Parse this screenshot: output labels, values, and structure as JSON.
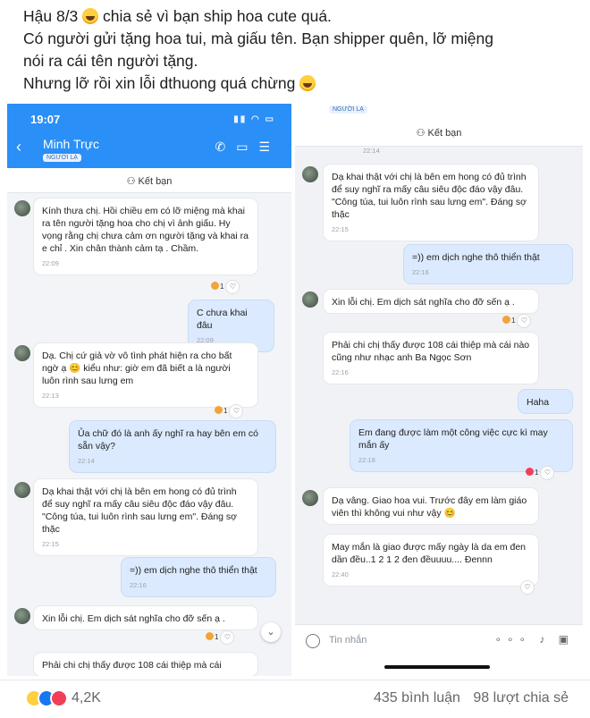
{
  "caption": {
    "line1_pre": "Hậu 8/3",
    "line1_post": "chia sẻ vì bạn ship hoa cute quá.",
    "line2": "Có người gửi tặng hoa tui, mà giấu tên. Bạn shipper quên, lỡ miệng",
    "line3": "nói ra cái tên người tặng.",
    "line4": "Nhưng lỡ rồi xin lỗi dthuong quá chừng",
    "emoji": "laughing-face-icon"
  },
  "left_phone": {
    "time": "19:07",
    "contact_name": "Minh Trực",
    "stranger_badge": "NGƯỜI LẠ",
    "add_friend": "Kết bạn",
    "messages": [
      {
        "text": "Kính thưa chị. Hồi chiều em có lỡ miệng mà khai ra tên người tặng hoa cho chị vì ảnh giấu. Hy vọng rằng chị chưa cảm ơn người tặng và khai ra e chỉ . Xin chân thành cảm tạ . Chầm.",
        "time": "22:09",
        "react": "1"
      },
      {
        "text": "C chưa khai đâu",
        "time": "22:09"
      },
      {
        "text": "Dạ. Chị cứ giả vờ vô tình phát hiện ra cho bất ngờ ạ 😊 kiểu như: giờ em đã biết a là người luôn rình sau lưng em",
        "time": "22:13",
        "react": "1"
      },
      {
        "text": "Ủa chữ đó là anh ấy nghĩ ra hay bên em có sẵn vậy?",
        "time": "22:14"
      },
      {
        "text": "Dạ khai thật với chị là bên em hong có đủ trình để suy nghĩ ra mấy câu siêu độc đáo vậy đâu. \"Công túa, tui luôn rình sau lưng em\". Đáng sợ thặc",
        "time": "22:15"
      },
      {
        "text": "=)) em dịch nghe thô thiển thật",
        "time": "22:16"
      },
      {
        "text": "Xin lỗi chị. Em dịch sát nghĩa cho đỡ sến ạ .",
        "react": "1"
      },
      {
        "text": "Phải chi chị thấy được 108 cái thiệp mà cái"
      }
    ]
  },
  "right_phone": {
    "stranger_badge": "NGƯỜI LẠ",
    "add_friend": "Kết bạn",
    "top_time": "22:14",
    "messages": [
      {
        "text": "Dạ khai thật với chị là bên em hong có đủ trình để suy nghĩ ra mấy câu siêu độc đáo vậy đâu. \"Công túa, tui luôn rình sau lưng em\". Đáng sợ thặc",
        "time": "22:15"
      },
      {
        "text": "=)) em dịch nghe thô thiển thật",
        "time": "22:16"
      },
      {
        "text": "Xin lỗi chị. Em dịch sát nghĩa cho đỡ sến ạ .",
        "react": "1"
      },
      {
        "text": "Phải chi chị thấy được 108 cái thiệp mà cái nào cũng như nhạc anh Ba Ngọc Sơn",
        "time": "22:16"
      },
      {
        "text": "Haha"
      },
      {
        "text": "Em đang được làm một công việc cực kì may mắn ấy",
        "time": "22:18",
        "react": "1"
      },
      {
        "text": "Dạ vâng. Giao hoa vui. Trước đây em làm giáo viên thì không vui như vậy 😊"
      },
      {
        "text": "May mắn là giao được mấy ngày là da em đen dần đều..1 2 1 2 đen đềuuuu.... Đennn",
        "time": "22:40"
      }
    ],
    "input_placeholder": "Tin nhắn"
  },
  "footer": {
    "reaction_count": "4,2K",
    "comments": "435 bình luận",
    "shares": "98 lượt chia sẻ"
  }
}
